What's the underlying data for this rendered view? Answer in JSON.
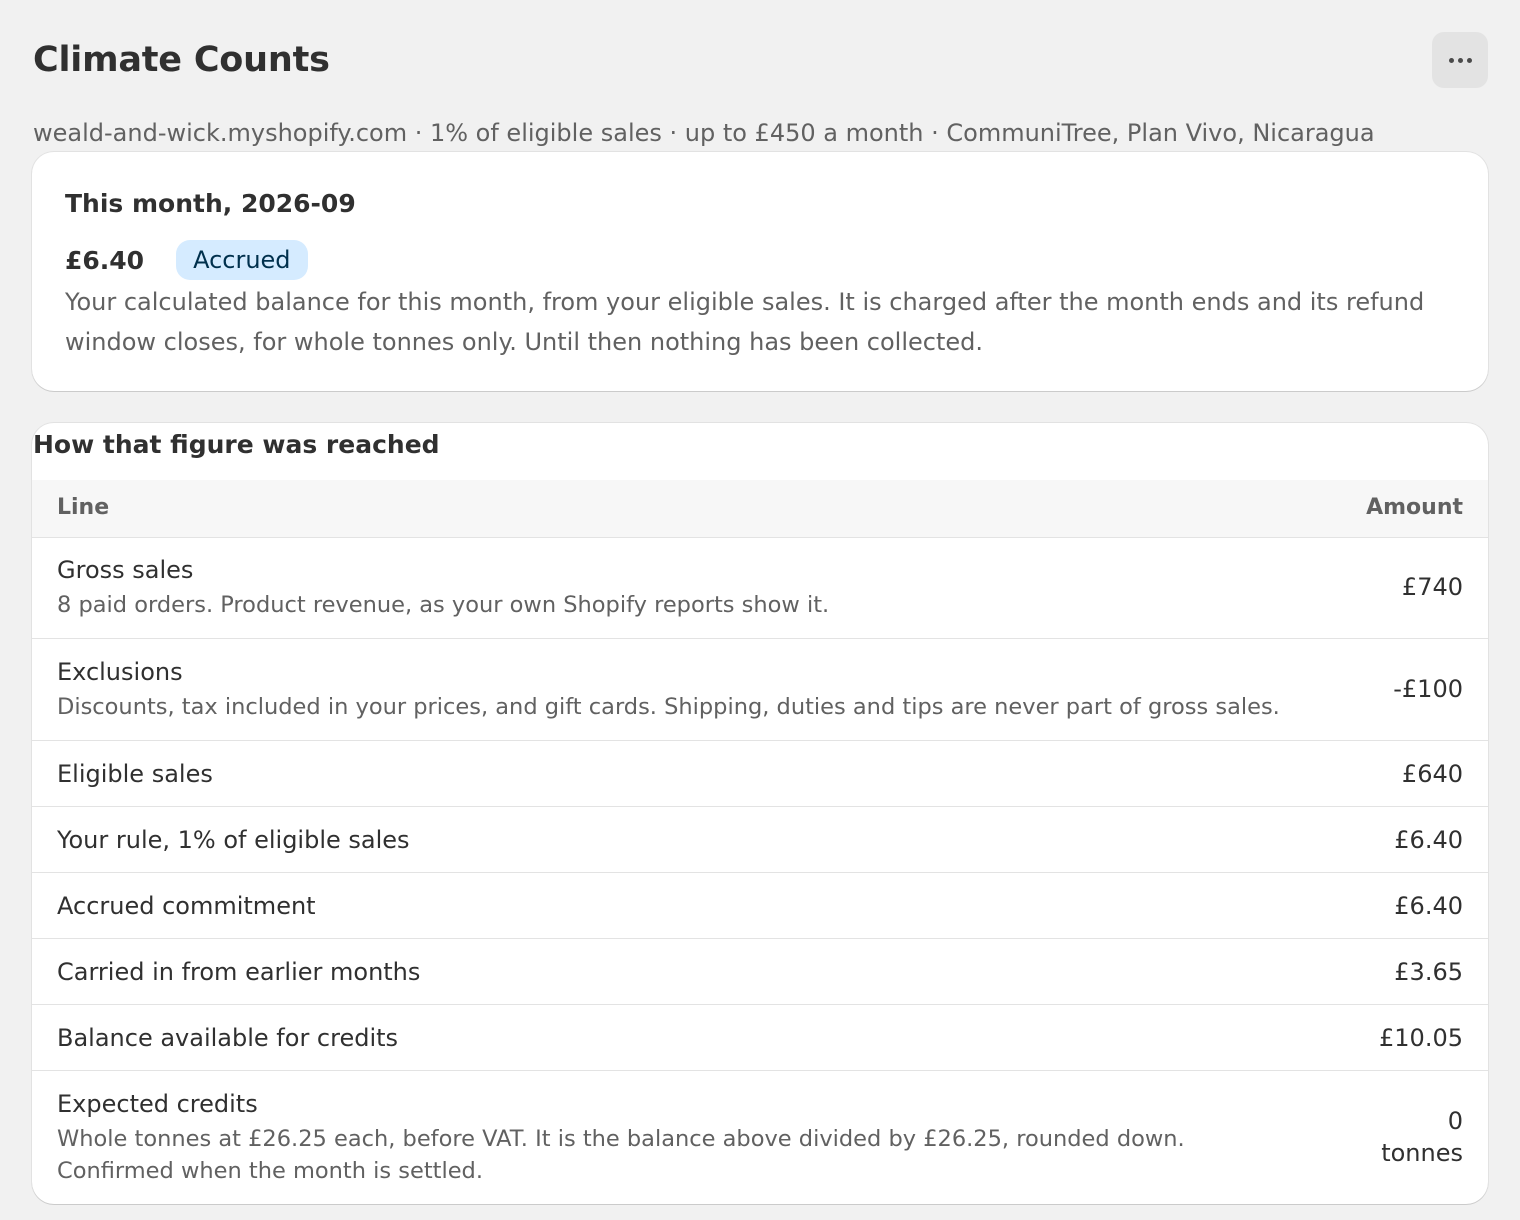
{
  "header": {
    "title": "Climate Counts",
    "more_icon": "more-horizontal-icon"
  },
  "subtitle": "weald-and-wick.myshopify.com · 1% of eligible sales · up to £450 a month · CommuniTree, Plan Vivo, Nicaragua",
  "summary": {
    "heading": "This month, 2026-09",
    "amount": "£6.40",
    "badge": "Accrued",
    "badge_color": "#d5ebff",
    "description": "Your calculated balance for this month, from your eligible sales. It is charged after the month ends and its refund window closes, for whole tonnes only. Until then nothing has been collected."
  },
  "breakdown": {
    "title": "How that figure was reached",
    "columns": [
      "Line",
      "Amount"
    ],
    "rows": [
      {
        "label": "Gross sales",
        "note": "8 paid orders. Product revenue, as your own Shopify reports show it.",
        "amount": "£740"
      },
      {
        "label": "Exclusions",
        "note": "Discounts, tax included in your prices, and gift cards. Shipping, duties and tips are never part of gross sales.",
        "amount": "-£100"
      },
      {
        "label": "Eligible sales",
        "amount": "£640"
      },
      {
        "label": "Your rule, 1% of eligible sales",
        "amount": "£6.40"
      },
      {
        "label": "Accrued commitment",
        "amount": "£6.40"
      },
      {
        "label": "Carried in from earlier months",
        "amount": "£3.65"
      },
      {
        "label": "Balance available for credits",
        "amount": "£10.05"
      },
      {
        "label": "Expected credits",
        "note": "Whole tonnes at £26.25 each, before VAT. It is the balance above divided by £26.25, rounded down. Confirmed when the month is settled.",
        "amount": "0",
        "unit": "tonnes"
      }
    ]
  }
}
